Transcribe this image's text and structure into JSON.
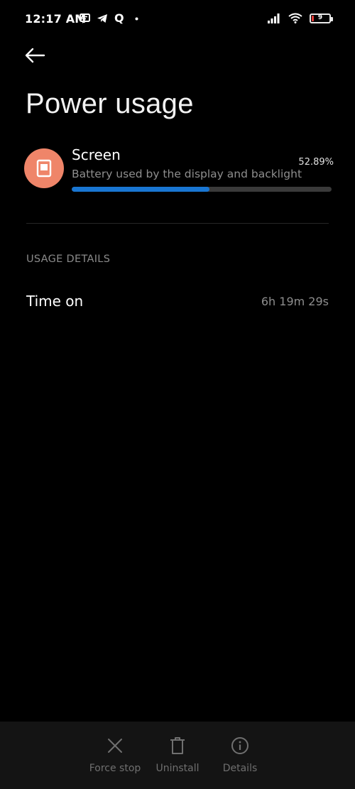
{
  "status_bar": {
    "time": "12:17 AM",
    "left_icons": [
      "message-icon",
      "telegram-icon",
      "q-app-icon",
      "dot-icon"
    ],
    "q_glyph": "Q",
    "right_icons": [
      "signal-icon",
      "wifi-icon",
      "battery-icon"
    ],
    "battery_level": "9",
    "battery_low_color": "#e53935"
  },
  "header": {
    "back_icon": "back-arrow-icon",
    "title": "Power usage"
  },
  "usage_item": {
    "icon": "screen-icon",
    "icon_bg": "#ef8569",
    "title": "Screen",
    "subtitle": "Battery used by the display and backlight",
    "percent": "52.89%",
    "progress": 0.5289,
    "progress_color": "#1976d2"
  },
  "section": {
    "header": "USAGE DETAILS",
    "rows": [
      {
        "label": "Time on",
        "value": "6h 19m 29s"
      }
    ]
  },
  "bottom_bar": {
    "actions": [
      {
        "icon": "close-icon",
        "label": "Force stop"
      },
      {
        "icon": "trash-icon",
        "label": "Uninstall"
      },
      {
        "icon": "info-icon",
        "label": "Details"
      }
    ]
  }
}
